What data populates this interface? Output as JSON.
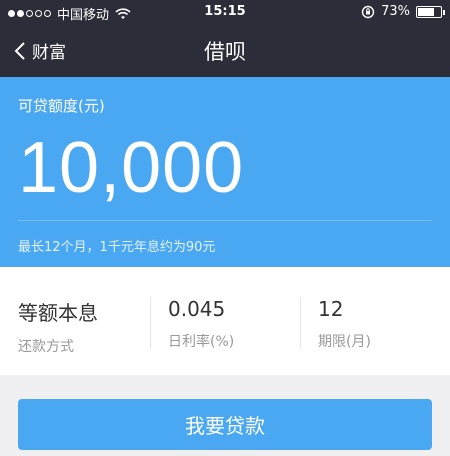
{
  "status_bar": {
    "carrier": "中国移动",
    "time": "15:15",
    "battery_percent": "73%",
    "battery_level": 0.73,
    "icons": [
      "signal-dots",
      "wifi-icon",
      "rotation-lock-icon",
      "battery-icon"
    ]
  },
  "nav": {
    "back_label": "财富",
    "title": "借呗"
  },
  "hero": {
    "label": "可贷额度(元)",
    "amount": "10,000",
    "note": "最长12个月，1千元年息约为90元"
  },
  "info": {
    "repayment": {
      "value": "等额本息",
      "label": "还款方式"
    },
    "rate": {
      "value": "0.045",
      "label": "日利率(%)"
    },
    "term": {
      "value": "12",
      "label": "期限(月)"
    }
  },
  "actions": {
    "borrow_label": "我要贷款"
  },
  "colors": {
    "header_bg": "#2b2d38",
    "accent": "#4aa7f2"
  }
}
